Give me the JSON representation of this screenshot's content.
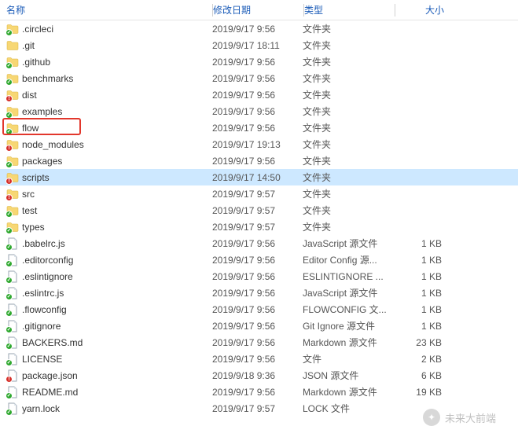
{
  "columns": {
    "name": "名称",
    "date": "修改日期",
    "type": "类型",
    "size": "大小"
  },
  "highlight_index": 6,
  "selected_index": 9,
  "rows": [
    {
      "icon": "folder",
      "badge": "green",
      "name": ".circleci",
      "date": "2019/9/17 9:56",
      "type": "文件夹",
      "size": ""
    },
    {
      "icon": "folder",
      "badge": "",
      "name": ".git",
      "date": "2019/9/17 18:11",
      "type": "文件夹",
      "size": ""
    },
    {
      "icon": "folder",
      "badge": "green",
      "name": ".github",
      "date": "2019/9/17 9:56",
      "type": "文件夹",
      "size": ""
    },
    {
      "icon": "folder",
      "badge": "green",
      "name": "benchmarks",
      "date": "2019/9/17 9:56",
      "type": "文件夹",
      "size": ""
    },
    {
      "icon": "folder",
      "badge": "red",
      "name": "dist",
      "date": "2019/9/17 9:56",
      "type": "文件夹",
      "size": ""
    },
    {
      "icon": "folder",
      "badge": "green",
      "name": "examples",
      "date": "2019/9/17 9:56",
      "type": "文件夹",
      "size": ""
    },
    {
      "icon": "folder",
      "badge": "green",
      "name": "flow",
      "date": "2019/9/17 9:56",
      "type": "文件夹",
      "size": ""
    },
    {
      "icon": "folder",
      "badge": "red",
      "name": "node_modules",
      "date": "2019/9/17 19:13",
      "type": "文件夹",
      "size": ""
    },
    {
      "icon": "folder",
      "badge": "green",
      "name": "packages",
      "date": "2019/9/17 9:56",
      "type": "文件夹",
      "size": ""
    },
    {
      "icon": "folder",
      "badge": "red",
      "name": "scripts",
      "date": "2019/9/17 14:50",
      "type": "文件夹",
      "size": ""
    },
    {
      "icon": "folder",
      "badge": "red",
      "name": "src",
      "date": "2019/9/17 9:57",
      "type": "文件夹",
      "size": ""
    },
    {
      "icon": "folder",
      "badge": "green",
      "name": "test",
      "date": "2019/9/17 9:57",
      "type": "文件夹",
      "size": ""
    },
    {
      "icon": "folder",
      "badge": "green",
      "name": "types",
      "date": "2019/9/17 9:57",
      "type": "文件夹",
      "size": ""
    },
    {
      "icon": "file",
      "badge": "green",
      "name": ".babelrc.js",
      "date": "2019/9/17 9:56",
      "type": "JavaScript 源文件",
      "size": "1 KB"
    },
    {
      "icon": "file",
      "badge": "green",
      "name": ".editorconfig",
      "date": "2019/9/17 9:56",
      "type": "Editor Config 源...",
      "size": "1 KB"
    },
    {
      "icon": "file",
      "badge": "green",
      "name": ".eslintignore",
      "date": "2019/9/17 9:56",
      "type": "ESLINTIGNORE ...",
      "size": "1 KB"
    },
    {
      "icon": "file",
      "badge": "green",
      "name": ".eslintrc.js",
      "date": "2019/9/17 9:56",
      "type": "JavaScript 源文件",
      "size": "1 KB"
    },
    {
      "icon": "file",
      "badge": "green",
      "name": ".flowconfig",
      "date": "2019/9/17 9:56",
      "type": "FLOWCONFIG 文...",
      "size": "1 KB"
    },
    {
      "icon": "file",
      "badge": "green",
      "name": ".gitignore",
      "date": "2019/9/17 9:56",
      "type": "Git Ignore 源文件",
      "size": "1 KB"
    },
    {
      "icon": "file",
      "badge": "green",
      "name": "BACKERS.md",
      "date": "2019/9/17 9:56",
      "type": "Markdown 源文件",
      "size": "23 KB"
    },
    {
      "icon": "file",
      "badge": "green",
      "name": "LICENSE",
      "date": "2019/9/17 9:56",
      "type": "文件",
      "size": "2 KB"
    },
    {
      "icon": "file",
      "badge": "red",
      "name": "package.json",
      "date": "2019/9/18 9:36",
      "type": "JSON 源文件",
      "size": "6 KB"
    },
    {
      "icon": "file",
      "badge": "green",
      "name": "README.md",
      "date": "2019/9/17 9:56",
      "type": "Markdown 源文件",
      "size": "19 KB"
    },
    {
      "icon": "file",
      "badge": "green",
      "name": "yarn.lock",
      "date": "2019/9/17 9:57",
      "type": "LOCK 文件",
      "size": ""
    }
  ],
  "watermark": "未来大前端"
}
